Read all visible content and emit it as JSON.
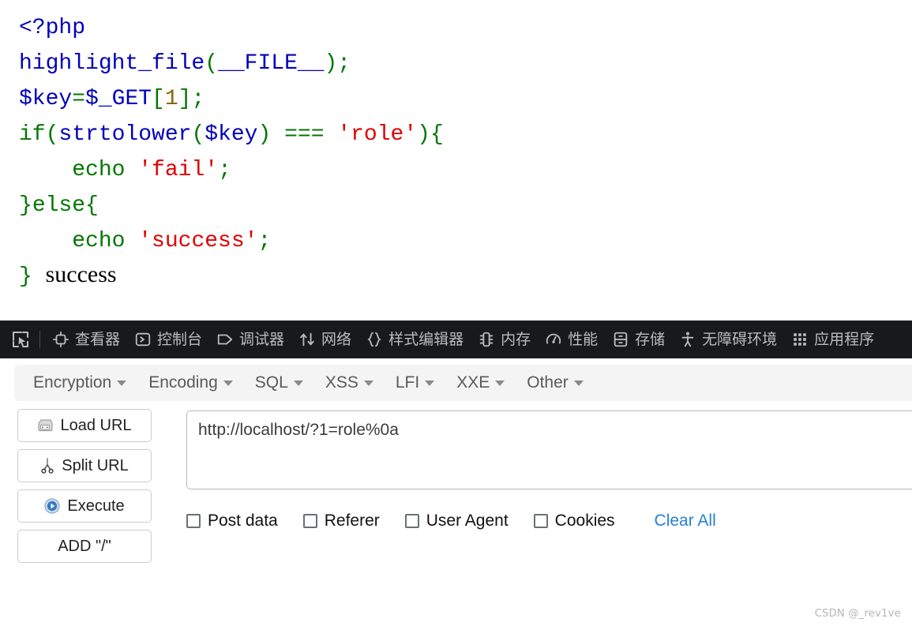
{
  "php_output": {
    "code_lines": [
      [
        {
          "t": "<?php",
          "c": "tok-default"
        }
      ],
      [
        {
          "t": "highlight_file",
          "c": "tok-default"
        },
        {
          "t": "(",
          "c": "tok-keyword"
        },
        {
          "t": "__FILE__",
          "c": "tok-default"
        },
        {
          "t": ")",
          "c": "tok-keyword"
        },
        {
          "t": ";",
          "c": "tok-keyword"
        }
      ],
      [
        {
          "t": "$key",
          "c": "tok-default"
        },
        {
          "t": "=",
          "c": "tok-keyword"
        },
        {
          "t": "$_GET",
          "c": "tok-default"
        },
        {
          "t": "[",
          "c": "tok-keyword"
        },
        {
          "t": "1",
          "c": "tok-number"
        },
        {
          "t": "]",
          "c": "tok-keyword"
        },
        {
          "t": ";",
          "c": "tok-keyword"
        }
      ],
      [
        {
          "t": "if",
          "c": "tok-keyword"
        },
        {
          "t": "(",
          "c": "tok-keyword"
        },
        {
          "t": "strtolower",
          "c": "tok-default"
        },
        {
          "t": "(",
          "c": "tok-keyword"
        },
        {
          "t": "$key",
          "c": "tok-default"
        },
        {
          "t": ") ",
          "c": "tok-keyword"
        },
        {
          "t": "=== ",
          "c": "tok-keyword"
        },
        {
          "t": "'role'",
          "c": "tok-string"
        },
        {
          "t": ")",
          "c": "tok-keyword"
        },
        {
          "t": "{",
          "c": "tok-keyword"
        }
      ],
      [
        {
          "t": "    ",
          "c": "tok-keyword"
        },
        {
          "t": "echo ",
          "c": "tok-keyword"
        },
        {
          "t": "'fail'",
          "c": "tok-string"
        },
        {
          "t": ";",
          "c": "tok-keyword"
        }
      ],
      [
        {
          "t": "}",
          "c": "tok-keyword"
        },
        {
          "t": "else",
          "c": "tok-keyword"
        },
        {
          "t": "{",
          "c": "tok-keyword"
        }
      ],
      [
        {
          "t": "    ",
          "c": "tok-keyword"
        },
        {
          "t": "echo ",
          "c": "tok-keyword"
        },
        {
          "t": "'success'",
          "c": "tok-string"
        },
        {
          "t": ";",
          "c": "tok-keyword"
        }
      ],
      [
        {
          "t": "}",
          "c": "tok-keyword"
        }
      ]
    ],
    "echo_result": "success",
    "colors": {
      "default": "#0000BB",
      "keyword": "#007700",
      "string": "#DD0000",
      "number": "#886600"
    }
  },
  "devtools": {
    "picker_icon": "element-picker-icon",
    "background": "#18191a",
    "tabs": [
      {
        "label": "查看器",
        "icon": "inspector-icon"
      },
      {
        "label": "控制台",
        "icon": "console-icon"
      },
      {
        "label": "调试器",
        "icon": "debugger-icon"
      },
      {
        "label": "网络",
        "icon": "network-icon"
      },
      {
        "label": "样式编辑器",
        "icon": "style-editor-icon"
      },
      {
        "label": "内存",
        "icon": "memory-icon"
      },
      {
        "label": "性能",
        "icon": "performance-icon"
      },
      {
        "label": "存储",
        "icon": "storage-icon"
      },
      {
        "label": "无障碍环境",
        "icon": "accessibility-icon"
      },
      {
        "label": "应用程序",
        "icon": "application-icon"
      }
    ]
  },
  "hackbar": {
    "menus": [
      {
        "label": "Encryption"
      },
      {
        "label": "Encoding"
      },
      {
        "label": "SQL"
      },
      {
        "label": "XSS"
      },
      {
        "label": "LFI"
      },
      {
        "label": "XXE"
      },
      {
        "label": "Other"
      }
    ],
    "buttons": [
      {
        "label": "Load URL",
        "icon": "load-url-icon"
      },
      {
        "label": "Split URL",
        "icon": "split-url-icon"
      },
      {
        "label": "Execute",
        "icon": "execute-icon"
      },
      {
        "label": "ADD \"/\"",
        "icon": "none"
      }
    ],
    "url_field": {
      "value": "http://localhost/?1=role%0a",
      "placeholder": ""
    },
    "options": [
      {
        "label": "Post data",
        "checked": false
      },
      {
        "label": "Referer",
        "checked": false
      },
      {
        "label": "User Agent",
        "checked": false
      },
      {
        "label": "Cookies",
        "checked": false
      }
    ],
    "clear_all_label": "Clear All",
    "accent_link_color": "#2a7fd4"
  },
  "watermark": {
    "text": "CSDN @_rev1ve"
  }
}
